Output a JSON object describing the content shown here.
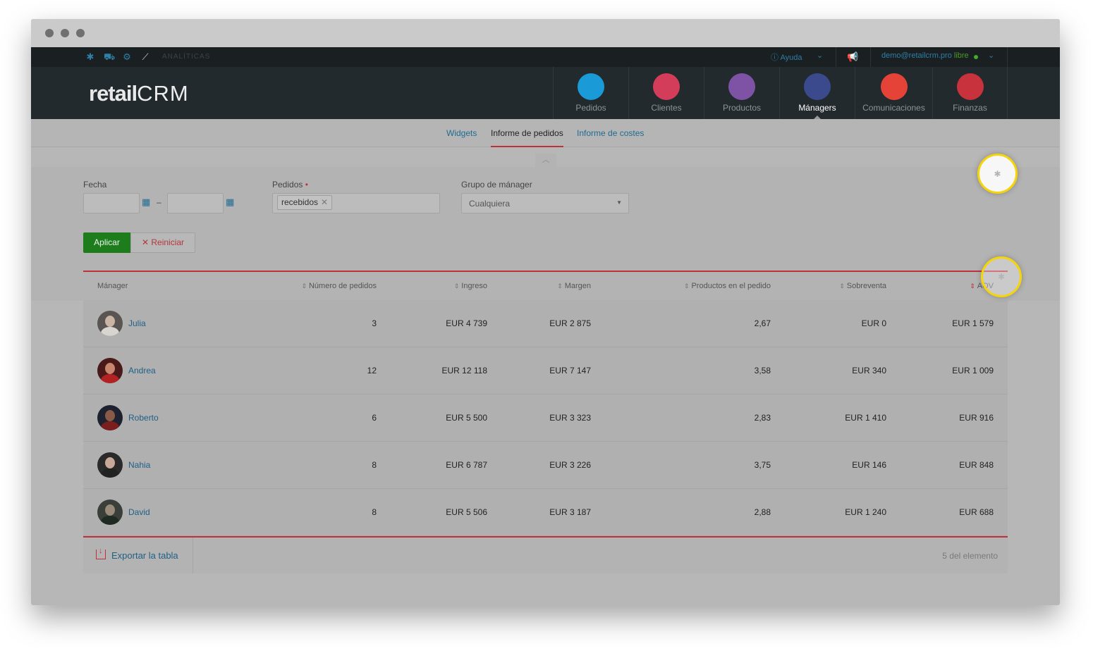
{
  "topbar": {
    "section_label": "ANALÍTICAS",
    "help": "Ayuda",
    "user_email": "demo@retailcrm.pro",
    "user_status": "libre"
  },
  "logo": {
    "text_a": "retail",
    "text_b": "CRM"
  },
  "nav": [
    {
      "label": "Pedidos",
      "icon": "cart-icon",
      "color": "#1a9ad6"
    },
    {
      "label": "Clientes",
      "icon": "customer-icon",
      "color": "#d43d5a"
    },
    {
      "label": "Productos",
      "icon": "box-icon",
      "color": "#7e53a5"
    },
    {
      "label": "Mánagers",
      "icon": "manager-icon",
      "color": "#3a4a8c",
      "active": true
    },
    {
      "label": "Comunicaciones",
      "icon": "chat-icon",
      "color": "#e64338"
    },
    {
      "label": "Finanzas",
      "icon": "finance-icon",
      "color": "#c7323c"
    }
  ],
  "subnav": {
    "tab1": "Widgets",
    "tab2": "Informe de pedidos",
    "tab3": "Informe de costes"
  },
  "filters": {
    "date_label": "Fecha",
    "date_sep": "–",
    "orders_label": "Pedidos",
    "orders_required": "•",
    "orders_chip": "recebidos",
    "group_label": "Grupo de mánager",
    "group_value": "Cualquiera",
    "apply": "Aplicar",
    "reset": "Reiniciar"
  },
  "table": {
    "headers": {
      "manager": "Mánager",
      "orders": "Número de pedidos",
      "income": "Ingreso",
      "margin": "Margen",
      "products": "Productos en el pedido",
      "upsell": "Sobreventa",
      "aov": "AOV"
    },
    "rows": [
      {
        "name": "Julia",
        "orders": "3",
        "income": "EUR 4 739",
        "margin": "EUR 2 875",
        "products": "2,67",
        "upsell": "EUR 0",
        "aov": "EUR 1 579"
      },
      {
        "name": "Andrea",
        "orders": "12",
        "income": "EUR 12 118",
        "margin": "EUR 7 147",
        "products": "3,58",
        "upsell": "EUR 340",
        "aov": "EUR 1 009"
      },
      {
        "name": "Roberto",
        "orders": "6",
        "income": "EUR 5 500",
        "margin": "EUR 3 323",
        "products": "2,83",
        "upsell": "EUR 1 410",
        "aov": "EUR 916"
      },
      {
        "name": "Nahia",
        "orders": "8",
        "income": "EUR 6 787",
        "margin": "EUR 3 226",
        "products": "3,75",
        "upsell": "EUR 146",
        "aov": "EUR 848"
      },
      {
        "name": "David",
        "orders": "8",
        "income": "EUR 5 506",
        "margin": "EUR 3 187",
        "products": "2,88",
        "upsell": "EUR 1 240",
        "aov": "EUR 688"
      }
    ],
    "export": "Exportar la tabla",
    "count": "5 del elemento"
  },
  "colors": {
    "accent_red": "#c0323a",
    "link_blue": "#1f6c93",
    "apply_green": "#1d7d1d",
    "highlight_ring": "#f6d40a"
  }
}
